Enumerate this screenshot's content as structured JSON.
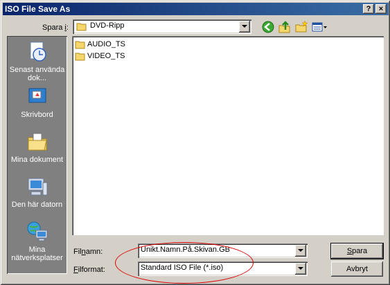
{
  "window": {
    "title": "ISO File Save As",
    "help_label": "?",
    "close_label": "×"
  },
  "save_in": {
    "label_prefix": "Spara ",
    "label_accel": "i",
    "label_suffix": ":",
    "value": "DVD-Ripp"
  },
  "places": [
    {
      "label": "Senast använda dok...",
      "icon": "recent-documents-icon"
    },
    {
      "label": "Skrivbord",
      "icon": "desktop-icon"
    },
    {
      "label": "Mina dokument",
      "icon": "my-documents-icon"
    },
    {
      "label": "Den här datorn",
      "icon": "my-computer-icon"
    },
    {
      "label": "Mina nätverksplatser",
      "icon": "network-places-icon"
    }
  ],
  "files": [
    {
      "name": "AUDIO_TS",
      "icon": "folder-icon"
    },
    {
      "name": "VIDEO_TS",
      "icon": "folder-icon"
    }
  ],
  "filename": {
    "label_accel": "n",
    "label_pre": "Fil",
    "label_post": "amn:",
    "value": "Unikt.Namn.På.Skivan.GB"
  },
  "filetype": {
    "label_accel": "F",
    "label_post": "ilformat:",
    "value": "Standard ISO File (*.iso)"
  },
  "buttons": {
    "save_accel": "S",
    "save_post": "para",
    "cancel": "Avbryt"
  },
  "colors": {
    "titlebar_start": "#0a246a",
    "titlebar_end": "#3a6ea5",
    "face": "#d4d0c8",
    "annotation": "#e00000"
  }
}
